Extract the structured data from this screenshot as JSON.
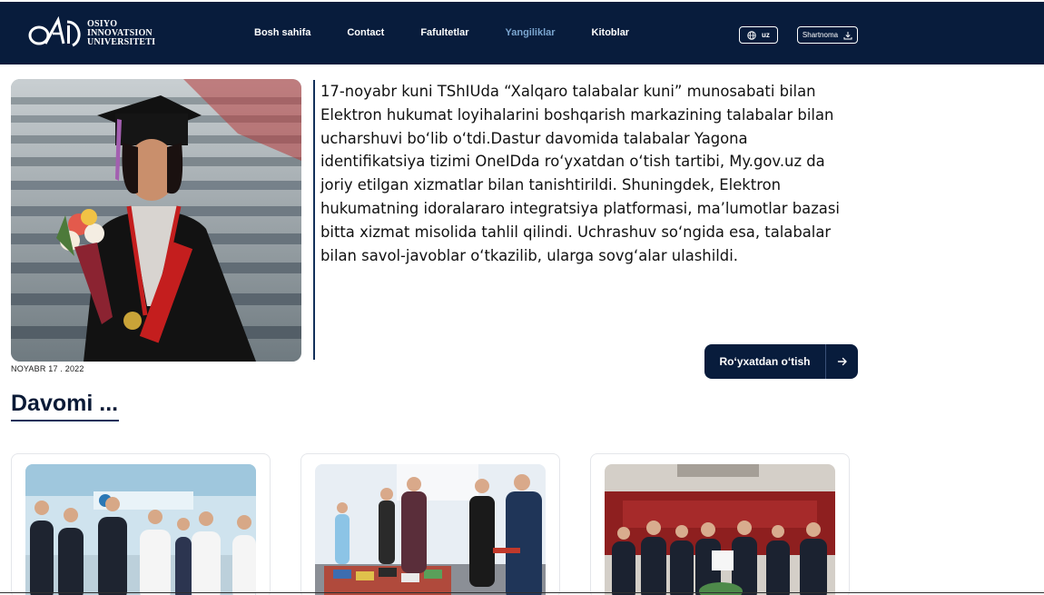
{
  "header": {
    "logo": {
      "line1": "OSIYO",
      "line2": "INNOVATSION",
      "line3": "UNIVERSITETI"
    },
    "nav": [
      {
        "label": "Bosh sahifa",
        "active": false
      },
      {
        "label": "Contact",
        "active": false
      },
      {
        "label": "Fafultetlar",
        "active": false
      },
      {
        "label": "Yangiliklar",
        "active": true
      },
      {
        "label": "Kitoblar",
        "active": false
      }
    ],
    "language": "uz",
    "contract_label": "Shartnoma"
  },
  "hero": {
    "date": "NOYABR 17 . 2022",
    "text": "17-noyabr kuni TShIUda “Xalqaro talabalar kuni” munosabati bilan Elektron hukumat loyihalarini boshqarish markazining talabalar bilan ucharshuvi bo‘lib o‘tdi.Dastur davomida talabalar Yagona identifikatsiya tizimi OneIDda ro‘yxatdan o‘tish tartibi, My.gov.uz da joriy etilgan xizmatlar bilan tanishtirildi. Shuningdek, Elektron hukumatning idoralararo integratsiya platformasi, ma’lumotlar bazasi bitta xizmat misolida tahlil qilindi. Uchrashuv so‘ngida esa, talabalar bilan savol-javoblar o‘tkazilib, ularga sovg‘alar ulashildi.",
    "register_button": "Ro‘yxatdan o‘tish"
  },
  "more_section": {
    "title": "Davomi ..."
  },
  "colors": {
    "header_bg": "#081c3c",
    "nav_active": "#7aa5cf",
    "accent": "#12305a"
  },
  "icons": {
    "language": "globe-icon",
    "contract": "download-icon",
    "register": "arrow-right-icon"
  }
}
